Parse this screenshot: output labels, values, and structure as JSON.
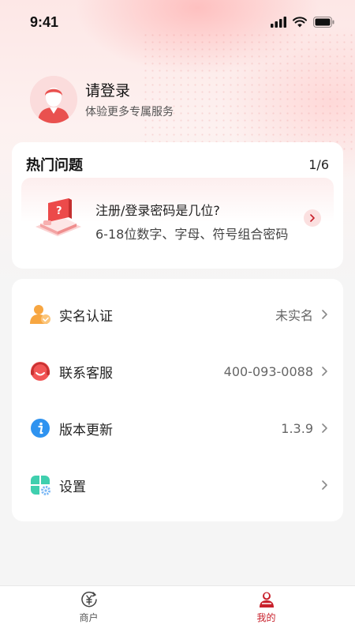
{
  "status_bar": {
    "time": "9:41"
  },
  "profile": {
    "title": "请登录",
    "subtitle": "体验更多专属服务"
  },
  "faq": {
    "title": "热门问题",
    "page_indicator": "1/6",
    "question": "注册/登录密码是几位?",
    "answer": "6-18位数字、字母、符号组合密码"
  },
  "menu": [
    {
      "label": "实名认证",
      "value": "未实名",
      "icon": "user-verify-icon"
    },
    {
      "label": "联系客服",
      "value": "400-093-0088",
      "icon": "customer-service-icon"
    },
    {
      "label": "版本更新",
      "value": "1.3.9",
      "icon": "info-icon"
    },
    {
      "label": "设置",
      "value": "",
      "icon": "settings-icon"
    }
  ],
  "tabbar": {
    "tabs": [
      {
        "label": "商户",
        "icon": "merchant-icon",
        "active": false
      },
      {
        "label": "我的",
        "icon": "profile-icon",
        "active": true
      }
    ]
  },
  "colors": {
    "accent": "#c8202b",
    "background": "#f5f5f5"
  }
}
